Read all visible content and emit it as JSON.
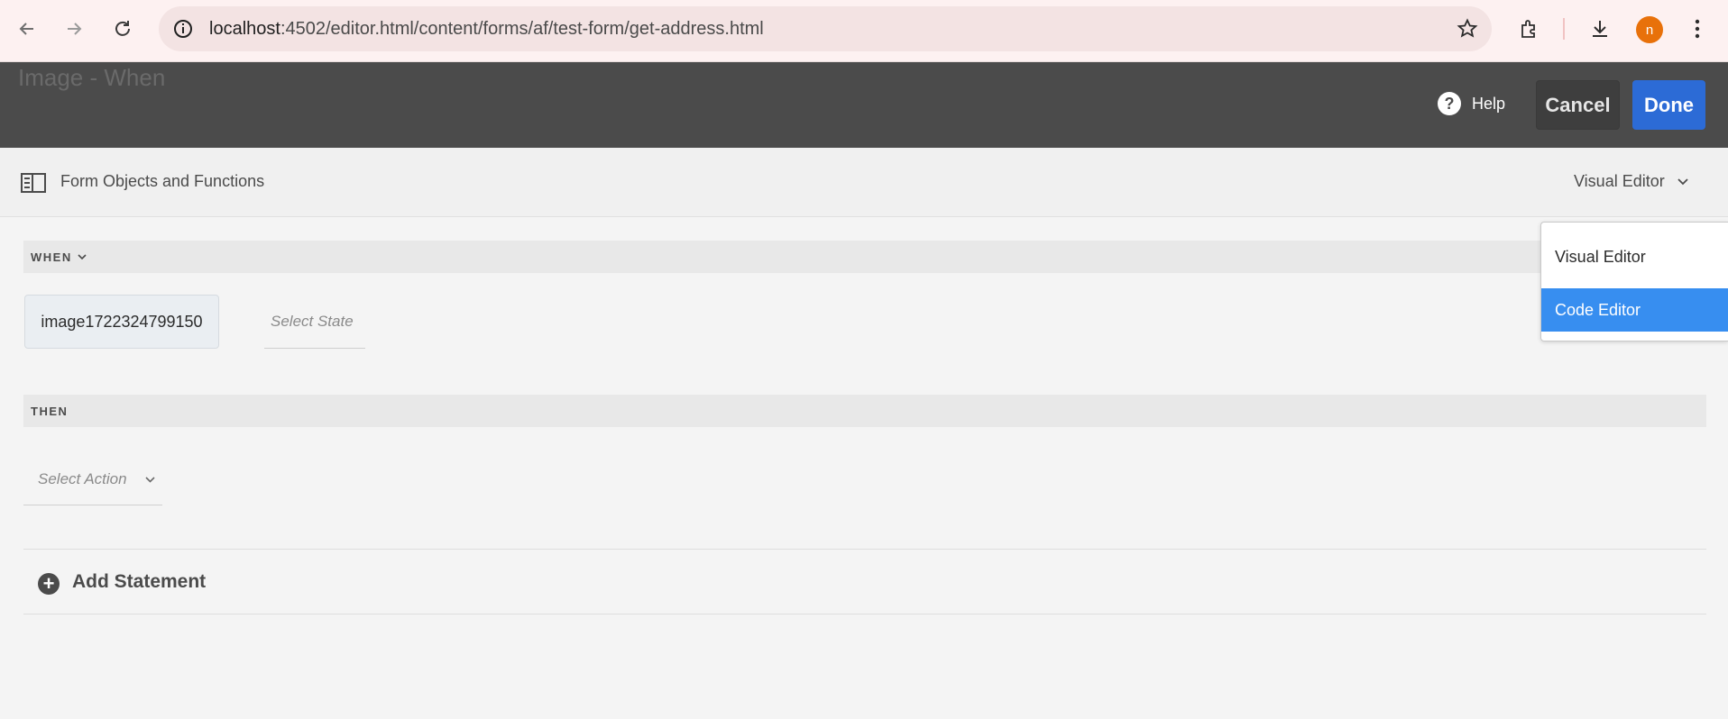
{
  "browser": {
    "url_host": "localhost",
    "url_path": ":4502/editor.html/content/forms/af/test-form/get-address.html",
    "profile_initial": "n"
  },
  "header": {
    "title": "Image - When",
    "help_label": "Help",
    "cancel_label": "Cancel",
    "done_label": "Done"
  },
  "toolbar": {
    "panel_label": "Form Objects and Functions",
    "editor_mode": "Visual Editor"
  },
  "when": {
    "section_label": "WHEN",
    "object_name": "image1722324799150",
    "state_placeholder": "Select State"
  },
  "then": {
    "section_label": "THEN",
    "action_placeholder": "Select Action"
  },
  "add_statement": {
    "label": "Add Statement"
  },
  "editor_menu": {
    "items": [
      {
        "label": "Visual Editor"
      },
      {
        "label": "Code Editor"
      }
    ],
    "highlighted_index": 1
  },
  "colors": {
    "header_bg": "#4b4b4b",
    "done_blue": "#2c6bd6",
    "menu_highlight": "#378ef0",
    "avatar": "#e8710a"
  }
}
